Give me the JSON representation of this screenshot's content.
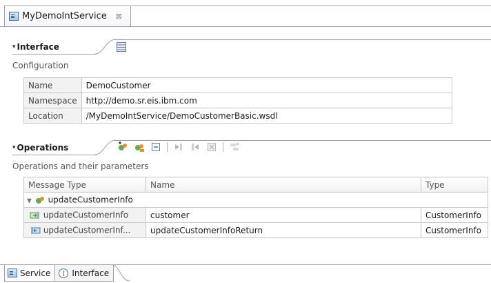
{
  "editor_tab": {
    "title": "MyDemoIntService",
    "close_glyph": "⊠"
  },
  "interface_section": {
    "title": "Interface",
    "subtitle": "Configuration",
    "rows": [
      {
        "key": "Name",
        "value": "DemoCustomer"
      },
      {
        "key": "Namespace",
        "value": "http://demo.sr.eis.ibm.com"
      },
      {
        "key": "Location",
        "value": "/MyDemoIntService/DemoCustomerBasic.wsdl"
      }
    ]
  },
  "operations_section": {
    "title": "Operations",
    "subtitle": "Operations and their parameters",
    "columns": [
      "Message Type",
      "Name",
      "Type"
    ],
    "operation": {
      "name": "updateCustomerInfo"
    },
    "params": [
      {
        "message_type": "updateCustomerInfo",
        "name": "customer",
        "type": "CustomerInfo",
        "direction": "input"
      },
      {
        "message_type": "updateCustomerInf...",
        "name": "updateCustomerInfoReturn",
        "type": "CustomerInfo",
        "direction": "output"
      }
    ]
  },
  "bottom_tabs": [
    {
      "label": "Service",
      "icon": "service-icon",
      "active": true
    },
    {
      "label": "Interface",
      "icon": "interface-icon",
      "active": false
    }
  ],
  "colors": {
    "border": "#9aa0a6",
    "grid": "#c7c7c7",
    "key_bg": "#f2f2f2"
  }
}
